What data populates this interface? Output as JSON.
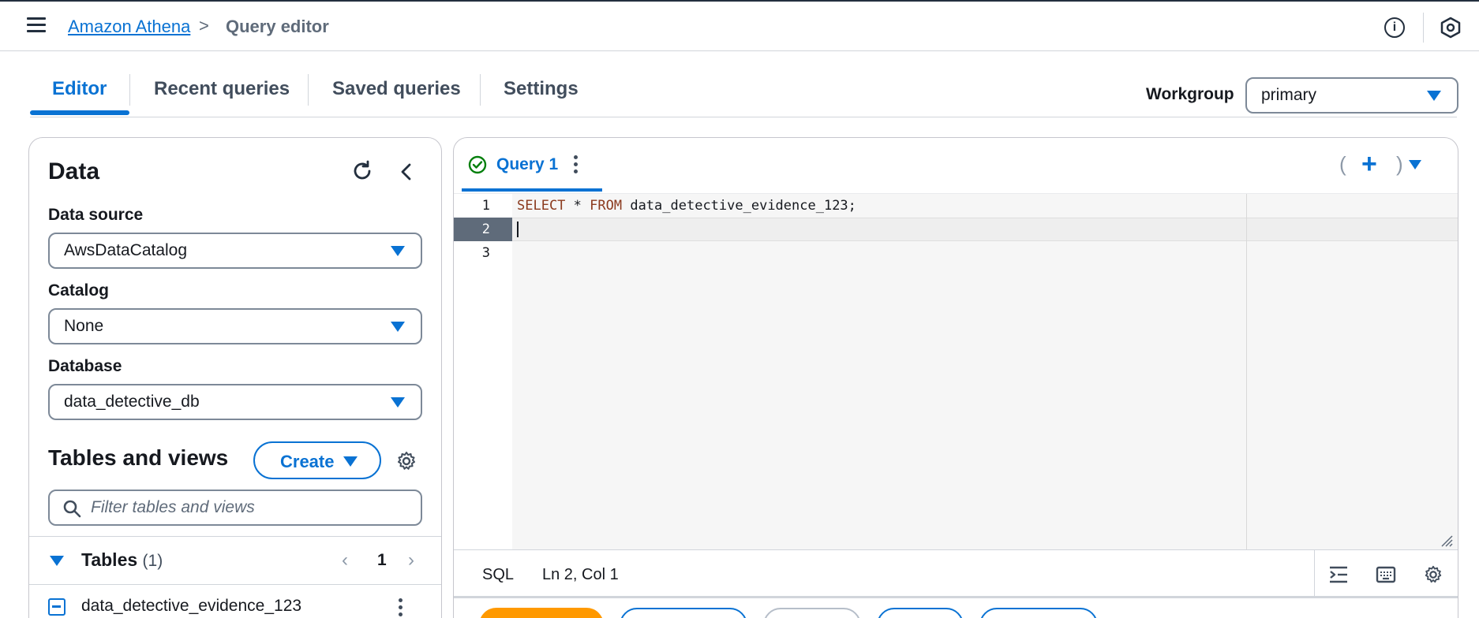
{
  "header": {
    "breadcrumb_link": "Amazon Athena",
    "breadcrumb_separator": ">",
    "breadcrumb_current": "Query editor",
    "info_icon_glyph": "i"
  },
  "tabs": [
    {
      "label": "Editor",
      "active": true
    },
    {
      "label": "Recent queries",
      "active": false
    },
    {
      "label": "Saved queries",
      "active": false
    },
    {
      "label": "Settings",
      "active": false
    }
  ],
  "workgroup": {
    "label": "Workgroup",
    "value": "primary"
  },
  "data_panel": {
    "title": "Data",
    "data_source": {
      "label": "Data source",
      "value": "AwsDataCatalog"
    },
    "catalog": {
      "label": "Catalog",
      "value": "None"
    },
    "database": {
      "label": "Database",
      "value": "data_detective_db"
    },
    "tables_views_title": "Tables and views",
    "create_label": "Create",
    "filter_placeholder": "Filter tables and views",
    "tables_section": {
      "title": "Tables",
      "count": "(1)",
      "page": "1"
    },
    "tables": [
      {
        "name": "data_detective_evidence_123"
      }
    ]
  },
  "editor": {
    "query_tab_label": "Query 1",
    "lines": [
      "1",
      "2",
      "3"
    ],
    "code": {
      "kw_select": "SELECT",
      "star": " * ",
      "kw_from": "FROM",
      "table": " data_detective_evidence_123;"
    },
    "status": {
      "language": "SQL",
      "position": "Ln 2, Col 1"
    }
  },
  "colors": {
    "accent": "#0972d3",
    "run_button": "#ff9900",
    "success": "#037f0c"
  }
}
